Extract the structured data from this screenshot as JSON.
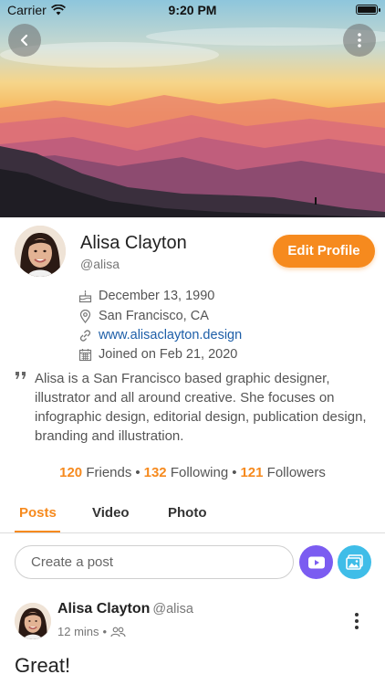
{
  "status_bar": {
    "carrier": "Carrier",
    "time": "9:20 PM"
  },
  "icons": {
    "back": "back-arrow-icon",
    "more": "more-vertical-icon",
    "birthday": "cake-icon",
    "location": "map-pin-icon",
    "website": "link-icon",
    "joined": "calendar-icon",
    "quote": "quote-icon",
    "video": "video-icon",
    "photo": "image-icon",
    "audience": "friends-icon"
  },
  "colors": {
    "accent": "#f68a1e",
    "link": "#1d5ea8",
    "video_button": "#7b5cf1",
    "photo_button": "#3fbde8"
  },
  "profile": {
    "name": "Alisa Clayton",
    "handle": "@alisa",
    "edit_label": "Edit Profile",
    "birthday": "December 13, 1990",
    "location": "San Francisco, CA",
    "website": "www.alisaclayton.design",
    "joined": "Joined on Feb 21, 2020",
    "bio": "Alisa is a San Francisco based graphic designer, illustrator and all around creative. She focuses on infographic design, editorial design, publication design, branding and illustration."
  },
  "stats": {
    "friends_count": "120",
    "friends_label": "Friends",
    "following_count": "132",
    "following_label": "Following",
    "followers_count": "121",
    "followers_label": "Followers",
    "separator": "•"
  },
  "tabs": [
    {
      "label": "Posts",
      "active": true
    },
    {
      "label": "Video",
      "active": false
    },
    {
      "label": "Photo",
      "active": false
    }
  ],
  "composer": {
    "placeholder": "Create a post"
  },
  "post": {
    "author": "Alisa Clayton",
    "handle": "@alisa",
    "time": "12 mins",
    "dot": "•",
    "text": "Great!"
  }
}
